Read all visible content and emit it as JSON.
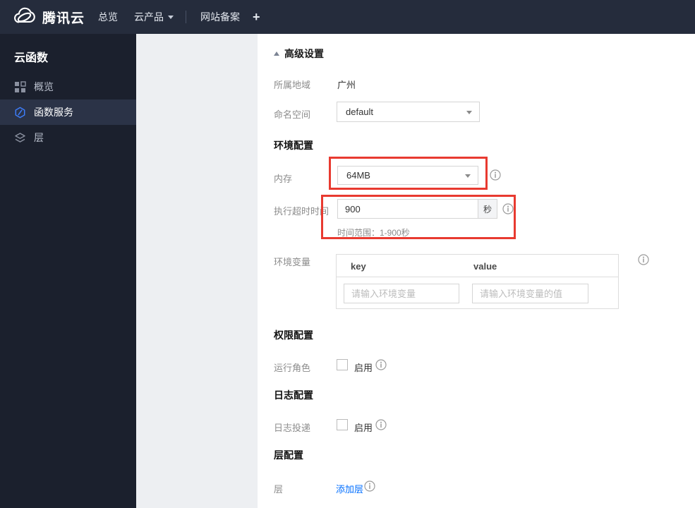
{
  "topnav": {
    "brand": "腾讯云",
    "items": [
      {
        "label": "总览"
      },
      {
        "label": "云产品"
      },
      {
        "label": "网站备案"
      },
      {
        "label": "+"
      }
    ]
  },
  "sidebar": {
    "title": "云函数",
    "items": [
      {
        "label": "概览",
        "icon": "grid-icon",
        "selected": false
      },
      {
        "label": "函数服务",
        "icon": "scf-hexagon-icon",
        "selected": true
      },
      {
        "label": "层",
        "icon": "layers-icon",
        "selected": false
      }
    ]
  },
  "form": {
    "advanced_toggle": "高级设置",
    "region": {
      "label": "所属地域",
      "value": "广州"
    },
    "namespace": {
      "label": "命名空间",
      "value": "default"
    },
    "section_env": "环境配置",
    "memory": {
      "label": "内存",
      "value": "64MB"
    },
    "timeout": {
      "label": "执行超时时间",
      "value": "900",
      "unit": "秒",
      "hint": "时间范围：1-900秒"
    },
    "envvars": {
      "label": "环境变量",
      "key_header": "key",
      "value_header": "value",
      "key_placeholder": "请输入环境变量",
      "value_placeholder": "请输入环境变量的值"
    },
    "section_perm": "权限配置",
    "role": {
      "label": "运行角色",
      "enable": "启用",
      "checked": false
    },
    "section_log": "日志配置",
    "logship": {
      "label": "日志投递",
      "enable": "启用",
      "checked": false
    },
    "section_layer": "层配置",
    "layer": {
      "label": "层",
      "add_link": "添加层"
    }
  },
  "colors": {
    "highlight_red": "#e83a30",
    "link_blue": "#006eff",
    "scf_icon_blue": "#3d7dfa",
    "nav_bg": "#252c3c",
    "sidebar_bg": "#1b202d"
  }
}
